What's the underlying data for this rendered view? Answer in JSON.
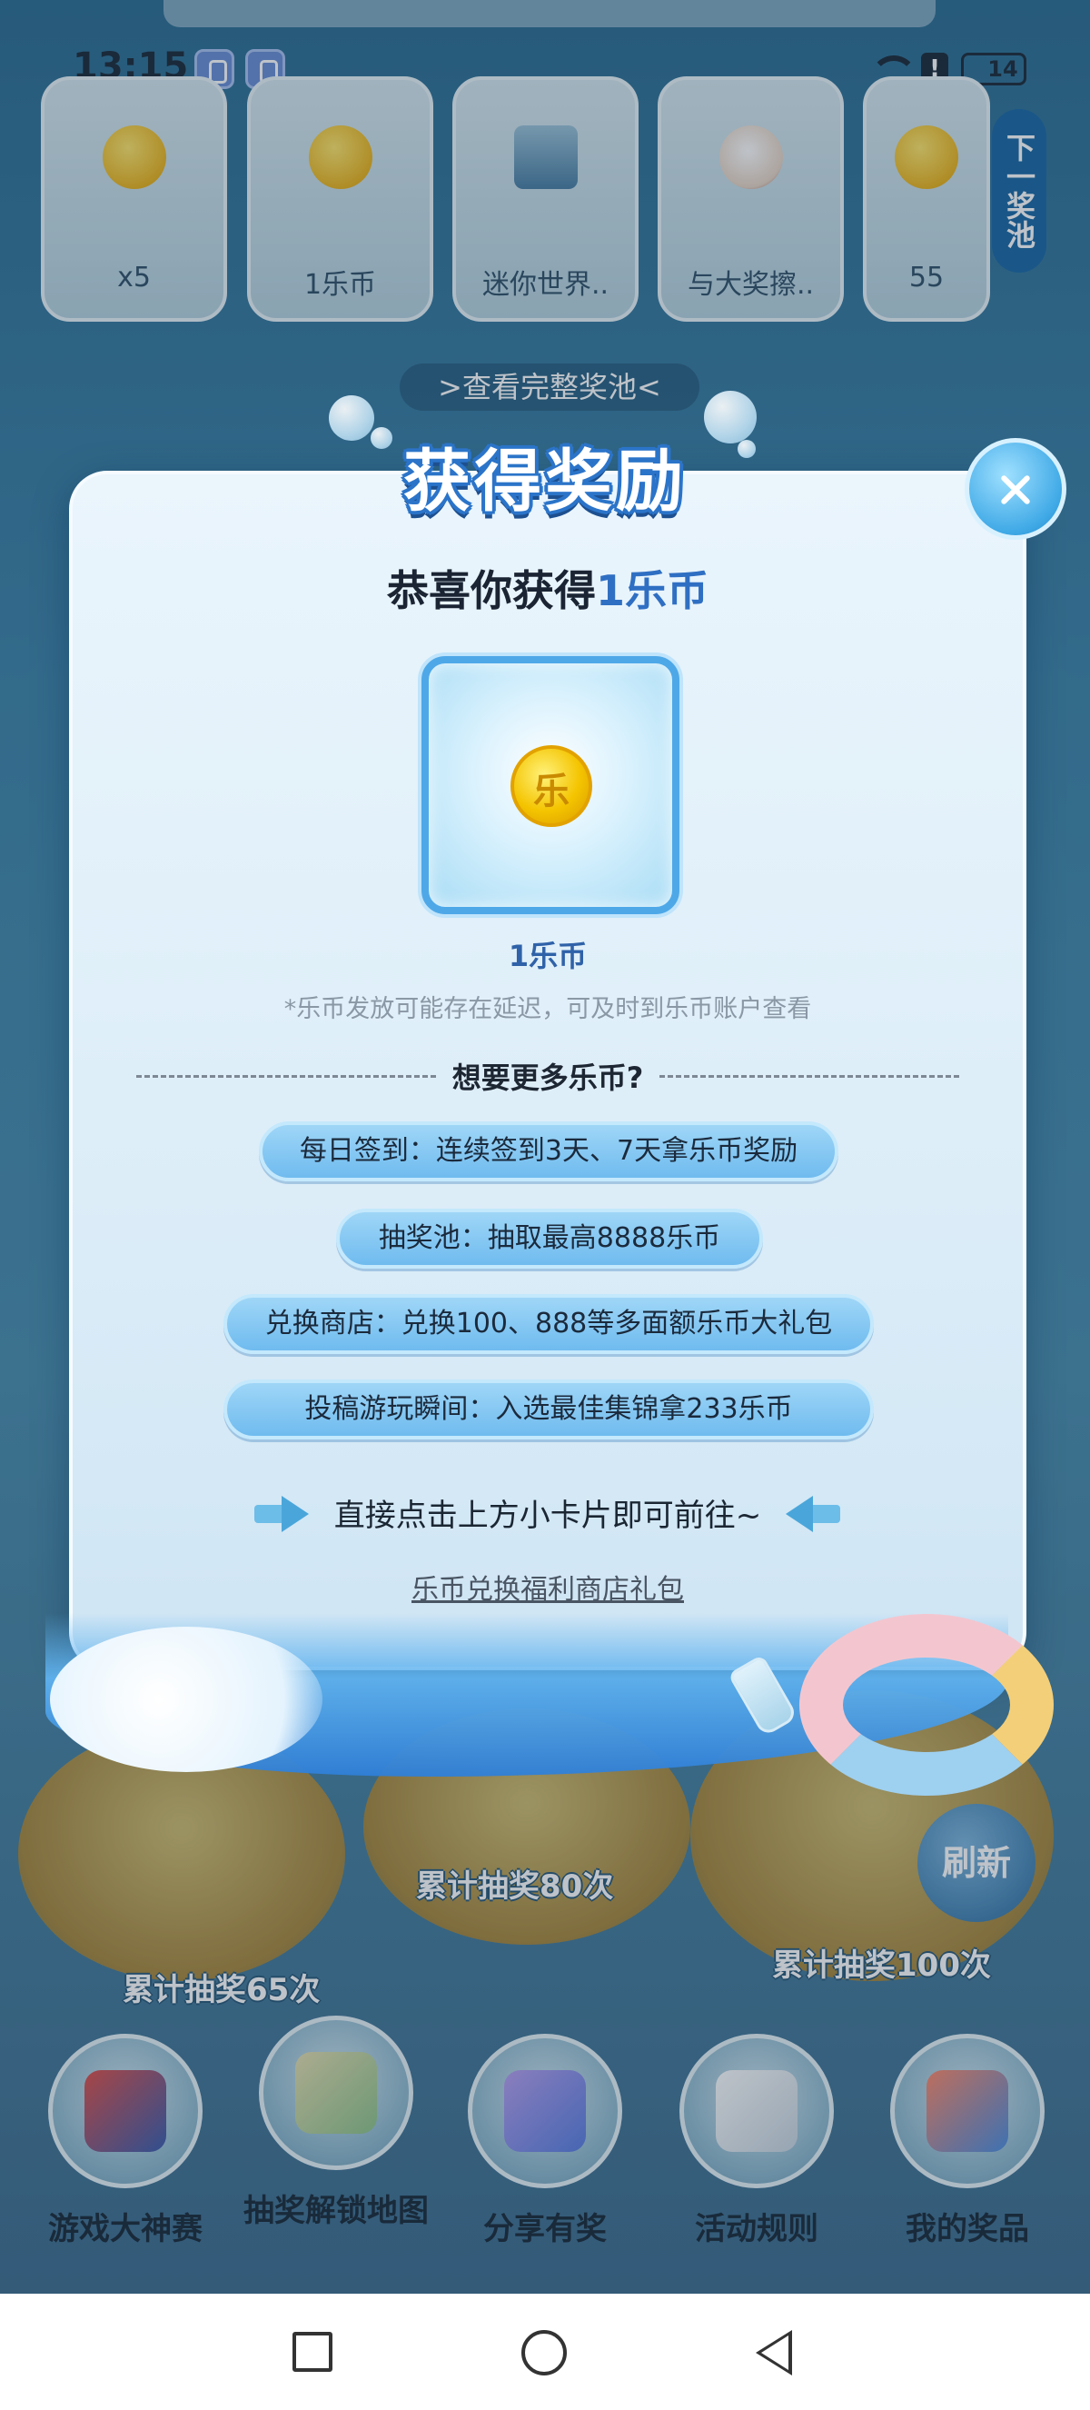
{
  "status_bar": {
    "time": "13:15",
    "battery": "14"
  },
  "prize_strip": {
    "items": [
      {
        "label": "x5"
      },
      {
        "label": "1乐币"
      },
      {
        "label": "迷你世界.."
      },
      {
        "label": "与大奖擦.."
      },
      {
        "label": "55"
      }
    ],
    "pool_tab": "下一奖池",
    "view_full_pool": ">查看完整奖池<"
  },
  "modal": {
    "title": "获得奖励",
    "congrats_prefix": "恭喜你获得",
    "congrats_reward": "1乐币",
    "reward_name": "1乐币",
    "reward_note": "*乐币发放可能存在延迟，可及时到乐币账户查看",
    "divider_text": "想要更多乐币?",
    "tips": [
      "每日签到：连续签到3天、7天拿乐币奖励",
      "抽奖池：抽取最高8888乐币",
      "兑换商店：兑换100、888等多面额乐币大礼包",
      "投稿游玩瞬间：入选最佳集锦拿233乐币"
    ],
    "hint": "直接点击上方小卡片即可前往~",
    "shop_link": "乐币兑换福利商店礼包"
  },
  "game": {
    "milestones": [
      "累计抽奖65次",
      "累计抽奖80次",
      "累计抽奖100次"
    ],
    "refresh_label": "刷新"
  },
  "bottom_nav": {
    "items": [
      {
        "label": "游戏大神赛"
      },
      {
        "label": "抽奖解锁地图"
      },
      {
        "label": "分享有奖"
      },
      {
        "label": "活动规则"
      },
      {
        "label": "我的奖品"
      }
    ]
  },
  "colors": {
    "accent_blue": "#2f6fc3",
    "pill_blue": "#6fbbef",
    "coin_gold": "#f4c400"
  }
}
